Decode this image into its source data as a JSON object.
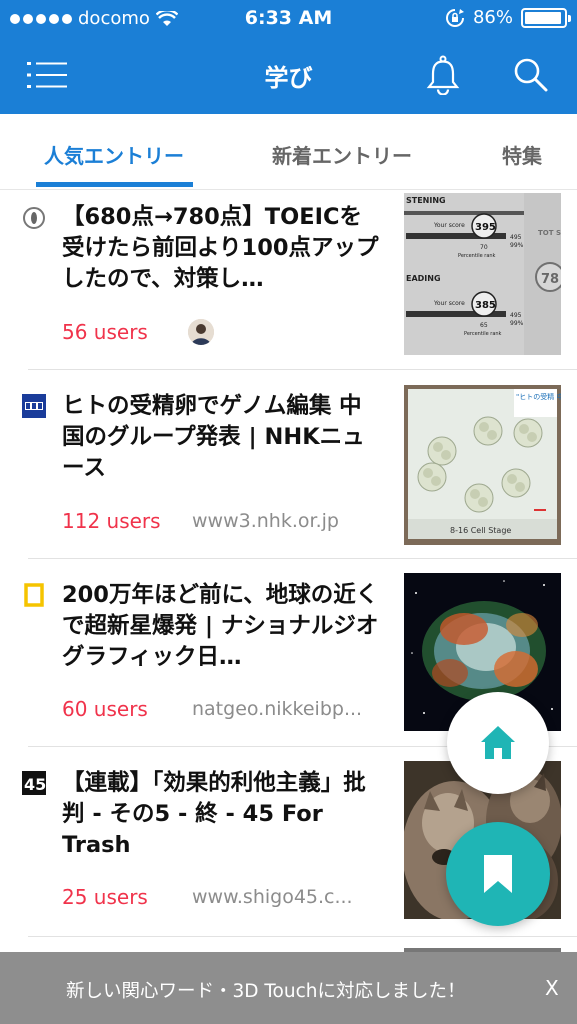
{
  "status_bar": {
    "carrier": "docomo",
    "time": "6:33 AM",
    "battery": "86%"
  },
  "nav": {
    "title": "学び",
    "menu_icon": "hamburger-icon",
    "bell_icon": "bell-icon",
    "search_icon": "search-icon"
  },
  "tabs": [
    {
      "label": "人気エントリー",
      "active": true
    },
    {
      "label": "新着エントリー",
      "active": false
    },
    {
      "label": "特集",
      "active": false
    }
  ],
  "entries": [
    {
      "title": "【680点→780点】TOEICを受けたら前回より100点アップしたので、対策し…",
      "users": "56 users",
      "domain": ""
    },
    {
      "title": "ヒトの受精卵でゲノム編集 中国のグループ発表 | NHKニュース",
      "users": "112 users",
      "domain": "www3.nhk.or.jp"
    },
    {
      "title": "200万年ほど前に、地球の近くで超新星爆発 | ナショナルジオグラフィック日…",
      "users": "60 users",
      "domain": "natgeo.nikkeibp..."
    },
    {
      "title": "【連載】「効果的利他主義」批判 - その5 - 終 - 45 For Trash",
      "users": "25 users",
      "domain": "www.shigo45.c..."
    }
  ],
  "thumb_texts": {
    "toeic_listening": "STENING",
    "toeic_reading": "EADING",
    "toeic_your_score": "Your score",
    "toeic_score1": "395",
    "toeic_score2": "385",
    "toeic_total": "TOT SCO",
    "toeic_total_val": "78",
    "toeic_pct1": "495",
    "toeic_pct2": "99%",
    "toeic_rank": "Percentile rank",
    "toeic_70": "70",
    "toeic_65": "65",
    "nhk_caption": "8-16 Cell Stage",
    "nhk_label": "\"ヒトの受精 中国の研"
  },
  "banner": {
    "text": "新しい関心ワード・3D Touchに対応しました！",
    "close": "X"
  },
  "colors": {
    "brand_blue": "#1b7fd6",
    "users_red": "#f0334b",
    "fab_teal": "#1fb5b5"
  }
}
